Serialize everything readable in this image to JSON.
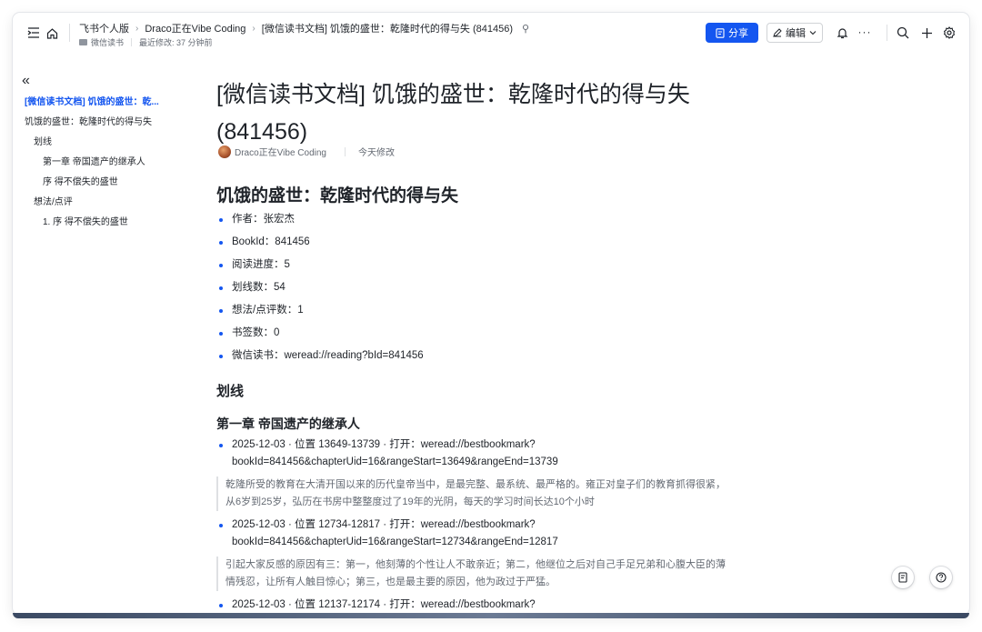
{
  "header": {
    "breadcrumb": [
      "飞书个人版",
      "Draco正在Vibe Coding",
      "[微信读书文档] 饥饿的盛世：乾隆时代的得与失 (841456)"
    ],
    "folder_label": "微信读书",
    "last_modified": "最近修改: 37 分钟前",
    "share_label": "分享",
    "edit_label": "编辑",
    "more_label": "···"
  },
  "outline": {
    "items": [
      {
        "label": "[微信读书文档] 饥饿的盛世：乾...",
        "level": 0,
        "active": true
      },
      {
        "label": "饥饿的盛世：乾隆时代的得与失",
        "level": 0,
        "active": false
      },
      {
        "label": "划线",
        "level": 1,
        "active": false
      },
      {
        "label": "第一章 帝国遗产的继承人",
        "level": 2,
        "active": false
      },
      {
        "label": "序 得不偿失的盛世",
        "level": 2,
        "active": false
      },
      {
        "label": "想法/点评",
        "level": 1,
        "active": false
      },
      {
        "label": "1. 序 得不偿失的盛世",
        "level": 2,
        "active": false
      }
    ]
  },
  "doc": {
    "title_line1": "[微信读书文档] 饥饿的盛世：乾隆时代的得与失",
    "title_line2": "(841456)",
    "author": "Draco正在Vibe Coding",
    "modified": "今天修改",
    "h1": "饥饿的盛世：乾隆时代的得与失",
    "meta": [
      "作者：张宏杰",
      "BookId：841456",
      "阅读进度：5",
      "划线数：54",
      "想法/点评数：1",
      "书签数：0",
      "微信读书：weread://reading?bId=841456"
    ],
    "section_highlights": "划线",
    "chapter1": "第一章 帝国遗产的继承人",
    "highlights": [
      {
        "line1": "2025-12-03 · 位置 13649-13739 · 打开：weread://bestbookmark?",
        "line2": "bookId=841456&chapterUid=16&rangeStart=13649&rangeEnd=13739",
        "quote1": "乾隆所受的教育在大清开国以来的历代皇帝当中，是最完整、最系统、最严格的。雍正对皇子们的教育抓得很紧，",
        "quote2": "从6岁到25岁，弘历在书房中整整度过了19年的光阴，每天的学习时间长达10个小时"
      },
      {
        "line1": "2025-12-03 · 位置 12734-12817 · 打开：weread://bestbookmark?",
        "line2": "bookId=841456&chapterUid=16&rangeStart=12734&rangeEnd=12817",
        "quote1": "引起大家反感的原因有三：第一，他刻薄的个性让人不敢亲近；第二，他继位之后对自己手足兄弟和心腹大臣的薄",
        "quote2": "情残忍，让所有人触目惊心；第三，也是最主要的原因，他为政过于严猛。"
      },
      {
        "line1": "2025-12-03 · 位置 12137-12174 · 打开：weread://bestbookmark?"
      }
    ]
  },
  "colors": {
    "accent": "#1456f0",
    "text": "#1f2329",
    "muted": "#646a73"
  }
}
